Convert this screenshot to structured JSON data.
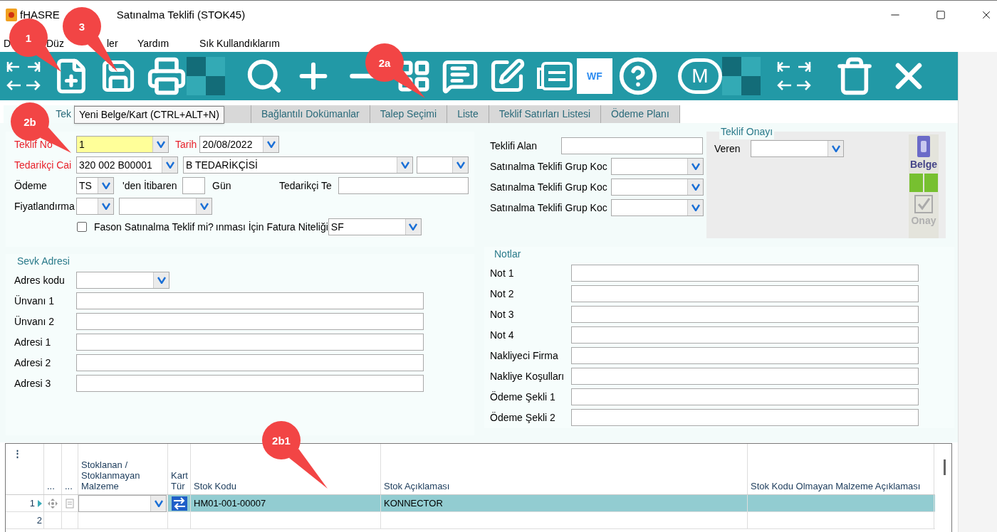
{
  "title": {
    "fragment": "fHASRE",
    "text": "Satınalma Teklifi (STOK45)"
  },
  "menu": [
    "D",
    "Düz",
    "ler",
    "Yardım",
    "Sık Kullandıklarım"
  ],
  "toolbar": {
    "wf_label": "WF",
    "m_label": "M"
  },
  "tabs": [
    {
      "label": "Tek",
      "selected": true
    },
    {
      "label": "Bağlantılı Dokümanlar",
      "selected": false
    },
    {
      "label": "Talep Seçimi",
      "selected": false
    },
    {
      "label": "Liste",
      "selected": false
    },
    {
      "label": "Teklif Satırları Listesi",
      "selected": false
    },
    {
      "label": "Ödeme Planı",
      "selected": false
    }
  ],
  "tooltip": "Yeni Belge/Kart (CTRL+ALT+N)",
  "header": {
    "teklif_no_label": "Teklif No",
    "teklif_no": "1",
    "tarih_label": "Tarih",
    "tarih": "20/08/2022",
    "tedarikci_label": "Tedarikçi Cai",
    "tedarikci_kodu": "320 002 B00001",
    "tedarikci_adi": "B TEDARİKÇİSİ",
    "odeme_label": "Ödeme",
    "odeme": "TS",
    "itibaren_label": "'den İtibaren",
    "gun_label": "Gün",
    "tedarikci_te_label": "Tedarikçi Te",
    "fiyat_label": "Fiyatlandırma",
    "fason_label": "Fason Satınalma Teklif mi?",
    "fason_checked": false,
    "fatura_label": "ınması İçin Fatura Niteliği",
    "fatura": "SF"
  },
  "right": {
    "teklifi_alan_label": "Teklifi Alan",
    "grup_labels": [
      "Satınalma Teklifi Grup Koc",
      "Satınalma Teklifi Grup Koc",
      "Satınalma Teklifi Grup Koc"
    ]
  },
  "onay": {
    "title": "Teklif Onayı",
    "veren_label": "Veren",
    "belge_label": "Belge",
    "onay_label": "Onay",
    "onay_disabled": true
  },
  "sevk": {
    "title": "Sevk Adresi",
    "code_label": "Adres kodu",
    "fields": [
      "Ünvanı 1",
      "Ünvanı 2",
      "Adresi 1",
      "Adresi 2",
      "Adresi 3"
    ]
  },
  "notlar": {
    "title": "Notlar",
    "fields": [
      "Not 1",
      "Not 2",
      "Not 3",
      "Not 4",
      "Nakliyeci Firma",
      "Nakliye Koşulları",
      "Ödeme Şekli 1",
      "Ödeme Şekli 2"
    ]
  },
  "grid": {
    "menu_glyph": "⋮",
    "columns": [
      "...",
      "...",
      "Stoklanan / Stoklanmayan Malzeme",
      "Kart Tür",
      "Stok Kodu",
      "Stok Açıklaması",
      "Stok Kodu Olmayan Malzeme Açıklaması"
    ],
    "rows": [
      {
        "number": "1",
        "selected": true,
        "stok_kodu": "HM01-001-00007",
        "stok_aciklamasi": "KONNECTOR"
      },
      {
        "number": "2",
        "selected": false
      }
    ]
  },
  "callouts": [
    {
      "label": "1"
    },
    {
      "label": "3"
    },
    {
      "label": "2a"
    },
    {
      "label": "2b"
    },
    {
      "label": "2b1"
    }
  ]
}
